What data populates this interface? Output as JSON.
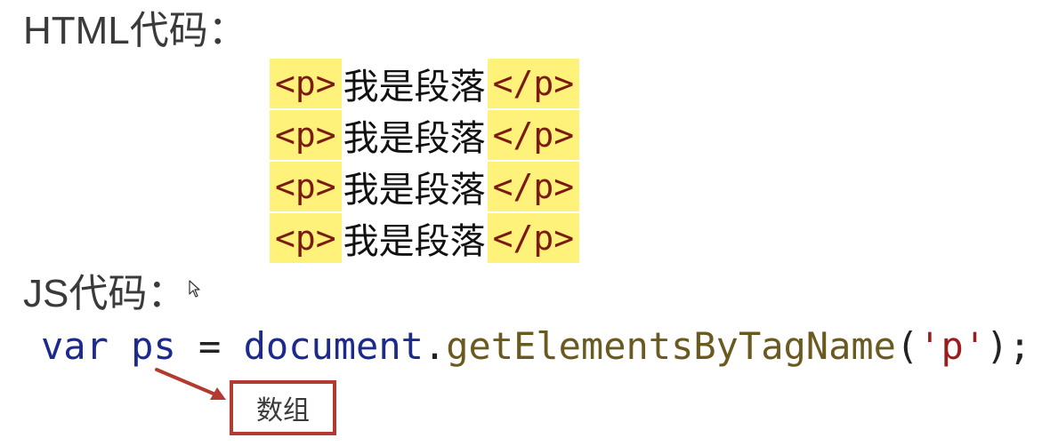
{
  "headings": {
    "html": "HTML代码：",
    "js": "JS代码："
  },
  "html_code": {
    "lines": [
      {
        "open_tag": "<p>",
        "text": "我是段落",
        "close_tag": "</p>"
      },
      {
        "open_tag": "<p>",
        "text": "我是段落",
        "close_tag": "</p>"
      },
      {
        "open_tag": "<p>",
        "text": "我是段落",
        "close_tag": "</p>"
      },
      {
        "open_tag": "<p>",
        "text": "我是段落",
        "close_tag": "</p>"
      }
    ]
  },
  "js_code": {
    "keyword": "var",
    "variable": "ps",
    "assign": "=",
    "object": "document",
    "dot": ".",
    "method": "getElementsByTagName",
    "open_paren": "(",
    "argument": "'p'",
    "close_paren": ");"
  },
  "annotation": {
    "label": "数组",
    "color": "#b23a2e"
  },
  "colors": {
    "tag_highlight": "#fff27a",
    "tag_text": "#7a1a10",
    "keyword": "#1b2a8c",
    "method": "#6a5a20",
    "string": "#9b1c1c"
  },
  "icons": {
    "cursor": "mouse-pointer-icon",
    "arrow": "arrow-icon"
  }
}
